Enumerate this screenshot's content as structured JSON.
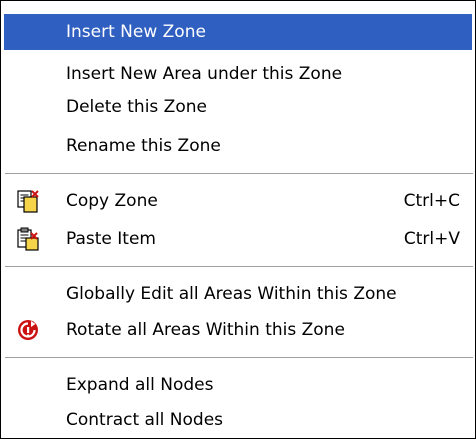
{
  "menu": {
    "items": [
      {
        "label": "Insert New Zone",
        "highlighted": true
      },
      {
        "label": "Insert New Area under this Zone"
      },
      {
        "label": "Delete this Zone"
      },
      {
        "label": "Rename this Zone"
      },
      {
        "label": "Copy Zone",
        "shortcut": "Ctrl+C",
        "icon": "copy-icon"
      },
      {
        "label": "Paste Item",
        "shortcut": "Ctrl+V",
        "icon": "paste-icon"
      },
      {
        "label": "Globally Edit all Areas Within this Zone"
      },
      {
        "label": "Rotate all Areas Within this Zone",
        "icon": "rotate-icon"
      },
      {
        "label": "Expand all Nodes"
      },
      {
        "label": "Contract all Nodes"
      }
    ]
  },
  "colors": {
    "highlight": "#2f5fc0",
    "highlight_text": "#ffffff",
    "rotate_icon": "#cc1111"
  }
}
